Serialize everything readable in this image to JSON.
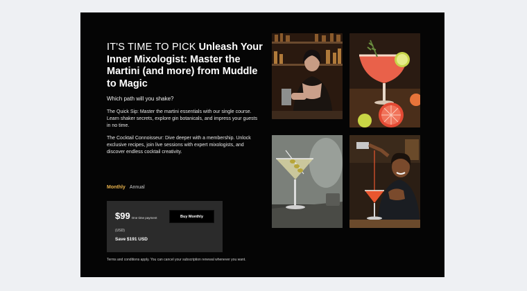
{
  "hero": {
    "headline_light": "IT'S TIME TO PICK",
    "headline_bold": "Unleash Your Inner Mixologist: Master the Martini (and more) from Muddle to Magic",
    "question": "Which path will you shake?",
    "paragraph_1": "The Quick Sip: Master the martini essentials with our single course. Learn shaker secrets, explore gin botanicals, and impress your guests in no time.",
    "paragraph_2": "The Cocktail Connoisseur: Dive deeper with a membership. Unlock exclusive recipes, join live sessions with expert mixologists, and discover endless cocktail creativity."
  },
  "billing": {
    "monthly_label": "Monthly",
    "annual_label": "Annual",
    "selected": "Monthly"
  },
  "pricing": {
    "price": "$99",
    "price_note": "One time payment",
    "currency": "(USD)",
    "savings": "Save $191 USD",
    "buy_label": "Buy Monthly"
  },
  "terms": "Terms and conditions apply. You can cancel your subscription renewal whenever you want.",
  "colors": {
    "card_background": "#050505",
    "accent": "#e8b24c",
    "price_box": "#2b2b2b",
    "page_background": "#eef0f3"
  }
}
